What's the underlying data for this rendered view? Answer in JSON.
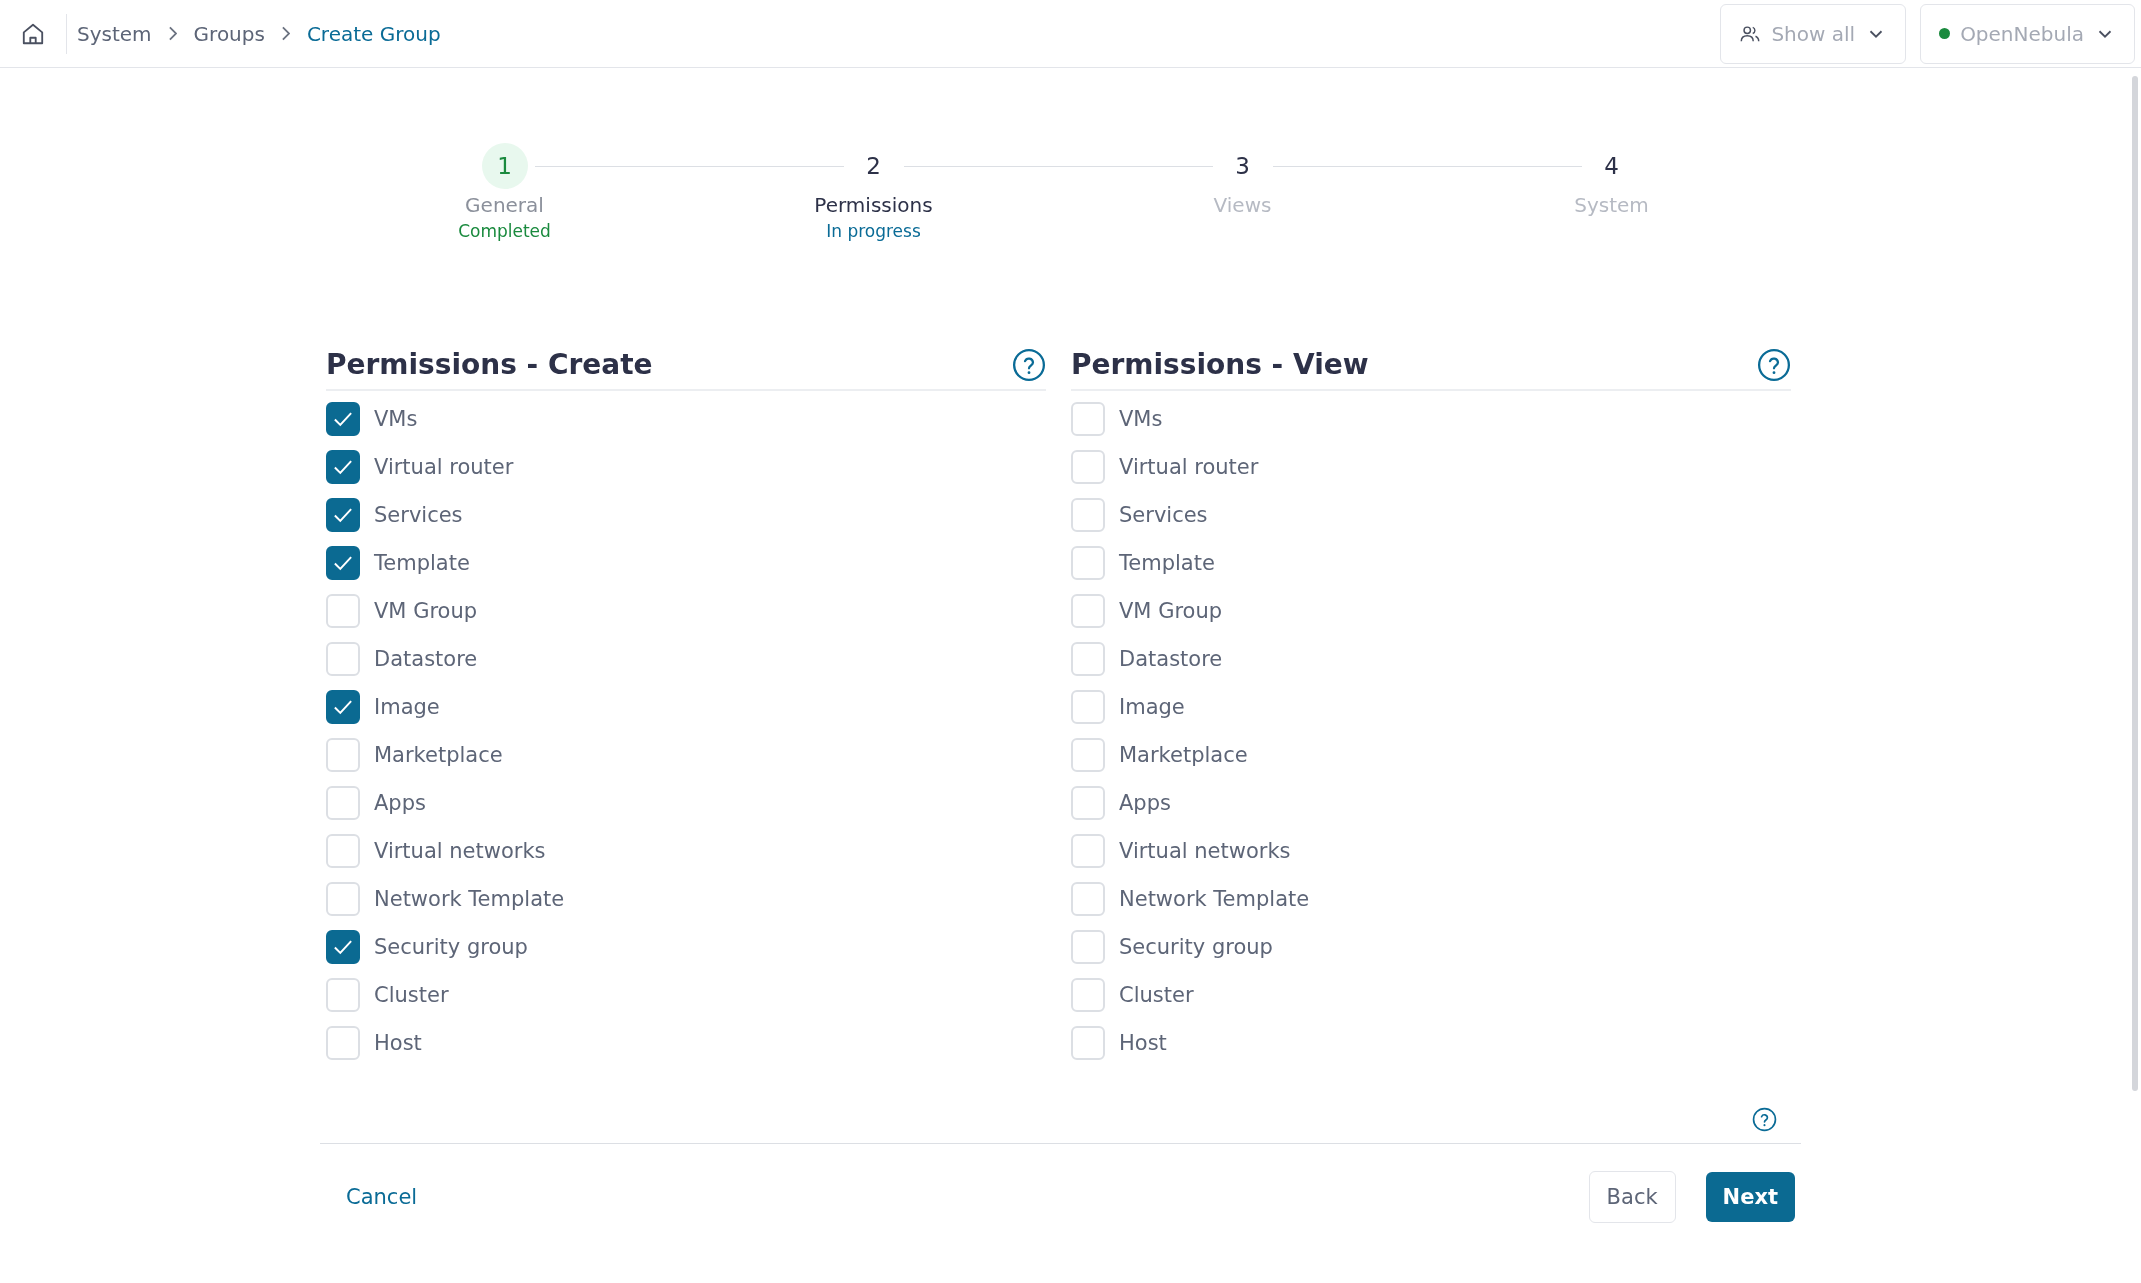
{
  "breadcrumbs": [
    {
      "label": "System",
      "current": false
    },
    {
      "label": "Groups",
      "current": false
    },
    {
      "label": "Create Group",
      "current": true
    }
  ],
  "toolbar": {
    "filter_button": "Show all",
    "zone_selector": {
      "label": "OpenNebula",
      "color": "#1a8a3e"
    }
  },
  "steps": [
    {
      "number": "1",
      "label": "General",
      "kind": "completed",
      "status": "Completed"
    },
    {
      "number": "2",
      "label": "Permissions",
      "kind": "in_progress",
      "status": "In progress"
    },
    {
      "number": "3",
      "label": "Views",
      "kind": "pending"
    },
    {
      "number": "4",
      "label": "System",
      "kind": "pending"
    }
  ],
  "panels": [
    {
      "title": "Permissions - Create",
      "items": [
        {
          "label": "VMs",
          "checked": true
        },
        {
          "label": "Virtual router",
          "checked": true
        },
        {
          "label": "Services",
          "checked": true
        },
        {
          "label": "Template",
          "checked": true
        },
        {
          "label": "VM Group",
          "checked": false
        },
        {
          "label": "Datastore",
          "checked": false
        },
        {
          "label": "Image",
          "checked": true
        },
        {
          "label": "Marketplace",
          "checked": false
        },
        {
          "label": "Apps",
          "checked": false
        },
        {
          "label": "Virtual networks",
          "checked": false
        },
        {
          "label": "Network Template",
          "checked": false
        },
        {
          "label": "Security group",
          "checked": true
        },
        {
          "label": "Cluster",
          "checked": false
        },
        {
          "label": "Host",
          "checked": false
        }
      ]
    },
    {
      "title": "Permissions - View",
      "items": [
        {
          "label": "VMs",
          "checked": false
        },
        {
          "label": "Virtual router",
          "checked": false
        },
        {
          "label": "Services",
          "checked": false
        },
        {
          "label": "Template",
          "checked": false
        },
        {
          "label": "VM Group",
          "checked": false
        },
        {
          "label": "Datastore",
          "checked": false
        },
        {
          "label": "Image",
          "checked": false
        },
        {
          "label": "Marketplace",
          "checked": false
        },
        {
          "label": "Apps",
          "checked": false
        },
        {
          "label": "Virtual networks",
          "checked": false
        },
        {
          "label": "Network Template",
          "checked": false
        },
        {
          "label": "Security group",
          "checked": false
        },
        {
          "label": "Cluster",
          "checked": false
        },
        {
          "label": "Host",
          "checked": false
        }
      ]
    }
  ],
  "footer": {
    "cancel": "Cancel",
    "back": "Back",
    "next": "Next"
  }
}
